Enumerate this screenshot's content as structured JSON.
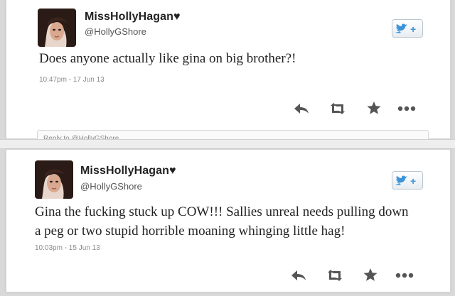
{
  "tweets": [
    {
      "display_name": "MissHollyHagan♥",
      "handle": "@HollyGShore",
      "text": "Does anyone actually like gina on big brother?!",
      "timestamp": "10:47pm - 17 Jun 13",
      "reply_preview": "Reply to @HollyGShore"
    },
    {
      "display_name": "MissHollyHagan♥",
      "handle": "@HollyGShore",
      "text_line1": "Gina the fucking stuck up COW!!! Sallies unreal needs pulling down",
      "text_line2": "a peg or two stupid horrible moaning whinging little hag!",
      "timestamp": "10:03pm - 15 Jun 13"
    }
  ],
  "icons": [
    "twitter-follow-icon",
    "reply-icon",
    "retweet-icon",
    "favorite-icon",
    "more-icon"
  ],
  "colors": {
    "twitter_blue": "#3b94d9",
    "action_gray": "#555555"
  }
}
